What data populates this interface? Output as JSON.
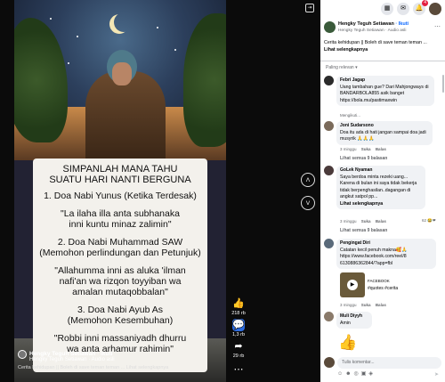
{
  "video": {
    "card_lines": [
      "SIMPANLAH MANA TAHU",
      "SUATU HARI NANTI BERGUNA",
      "1. Doa Nabi Yunus (Ketika Terdesak)",
      "\"La ilaha illa anta subhanaka",
      "inni kuntu minaz zalimin\"",
      "2. Doa Nabi Muhammad SAW",
      "(Memohon perlindungan dan Petunjuk)",
      "\"Allahumma inni as aluka 'ilman",
      "nafi'an wa rizqon toyyiban wa",
      "amalan mutaqobbalan\"",
      "3. Doa Nabi Ayub As",
      "(Memohon Kesembuhan)",
      "\"Robbi inni massaniyadh dhurru",
      "wa anta arhamur rahimin\""
    ],
    "overlay_author": "Hengky Teguh Setiawan · Ikuti",
    "overlay_sub": "Hengky Teguh Setiawan · Audio asli",
    "overlay_caption": "Cerita kehidupan || Boleh di save teman teman ... Lihat selengkapnya"
  },
  "rail": {
    "likes": "218 rb",
    "comments": "1,3 rb",
    "shares": "29 rb"
  },
  "topbar": {
    "notifications_badge": "4"
  },
  "post": {
    "author": "Hengky Teguh Setiawan",
    "follow": "· Ikuti",
    "sub": "Hengky Teguh Setiawan · Audio asli",
    "caption": "Cerita kehidupan || Boleh di save teman teman ...",
    "see_more": "Lihat selengkapnya"
  },
  "sort_label": "Paling relevan ▾",
  "comments": [
    {
      "name": "Febri Jagap",
      "text": "Uang tambahan gue? Dari Mahjongways di BANDARBOLA855 asik banget https://bola.mu/pastimaxwin",
      "meta": "Mengikuti..."
    },
    {
      "name": "Joni Sudarsono",
      "text": "Doa itu ada di hati jangan sampai doa jadi musyrik 🙏🙏🙏",
      "meta": "3 minggu",
      "reply": "Suka",
      "reply2": "Balas",
      "replies": "Lihat semua 9 balasan"
    },
    {
      "name": "GoLek Nyaman",
      "text": "Saya berdoa minta rezeki uang... Karena di bulan ini saya tidak bekerja tidak berpenghasilan..dagangan di angkut satpol pp...",
      "see_more": "Lihat selengkapnya",
      "meta": "3 minggu",
      "reply": "Suka",
      "reply2": "Balas",
      "count": "62",
      "replies": "Lihat semua 9 balasan"
    },
    {
      "name": "Pengingat Diri",
      "text": "Catatan kecil penuh makna🥰🙏 https://www.facebook.com/reel/8 6130886362844/?app=fbl",
      "link_title": "FACEBOOK",
      "link_tags": "#quotes #cerita",
      "meta": "3 minggu",
      "reply": "Suka",
      "reply2": "Balas"
    },
    {
      "name": "Muli Diyyh",
      "text": "Amin"
    }
  ],
  "reply_placeholder": "Tulis komentar..."
}
